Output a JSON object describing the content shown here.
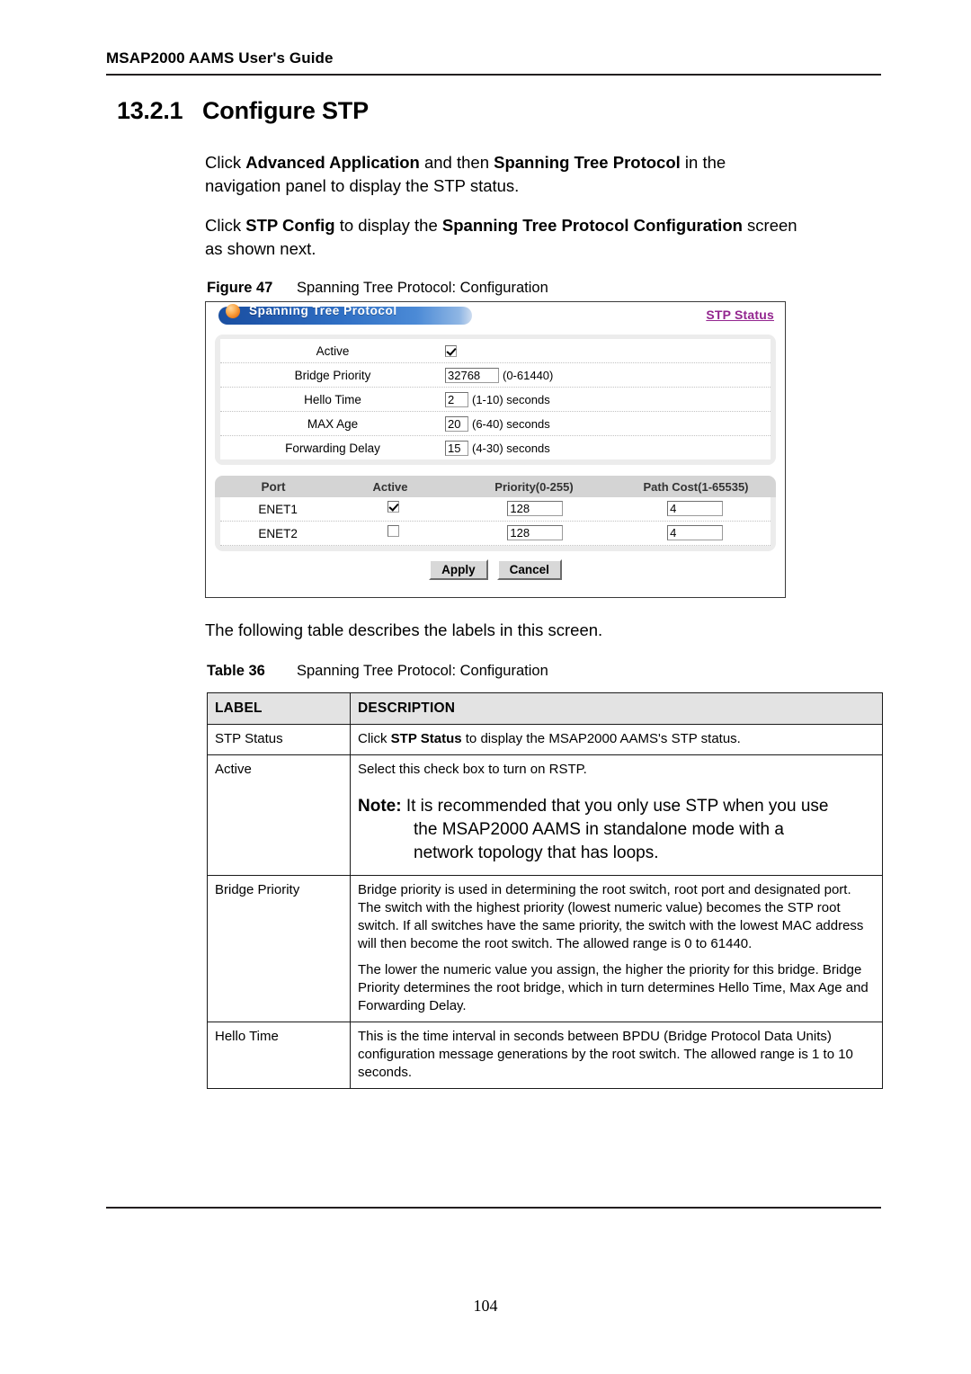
{
  "header": {
    "running_title": "MSAP2000 AAMS User's Guide"
  },
  "heading": {
    "number": "13.2.1",
    "title": "Configure STP"
  },
  "paragraphs": {
    "p1_a": "Click ",
    "p1_b1": "Advanced Application",
    "p1_c": " and then ",
    "p1_b2": "Spanning Tree Protocol",
    "p1_d": " in the navigation panel to display the STP status.",
    "p2_a": "Click ",
    "p2_b1": "STP Config",
    "p2_c": " to display the ",
    "p2_b2": "Spanning Tree Protocol Configuration",
    "p2_d": " screen as shown next.",
    "p3": "The following table describes the labels in this screen."
  },
  "figure": {
    "caption_label": "Figure 47",
    "caption_text": "Spanning Tree Protocol: Configuration",
    "screen": {
      "panel_title": "Spanning Tree Protocol",
      "status_link": "STP Status",
      "accent_blue": "#2f6fc4",
      "accent_orange": "#ec7a17",
      "link_color": "#93268f",
      "settings": [
        {
          "label": "Active",
          "type": "checkbox",
          "checked": true,
          "value": "",
          "hint": ""
        },
        {
          "label": "Bridge Priority",
          "type": "text",
          "checked": false,
          "value": "32768",
          "hint": "(0-61440)"
        },
        {
          "label": "Hello Time",
          "type": "text",
          "checked": false,
          "value": "2",
          "hint": "(1-10) seconds"
        },
        {
          "label": "MAX Age",
          "type": "text",
          "checked": false,
          "value": "20",
          "hint": "(6-40) seconds"
        },
        {
          "label": "Forwarding Delay",
          "type": "text",
          "checked": false,
          "value": "15",
          "hint": "(4-30) seconds"
        }
      ],
      "port_table": {
        "columns": [
          "Port",
          "Active",
          "Priority(0-255)",
          "Path Cost(1-65535)"
        ],
        "rows": [
          {
            "port": "ENET1",
            "active": true,
            "priority": "128",
            "path_cost": "4"
          },
          {
            "port": "ENET2",
            "active": false,
            "priority": "128",
            "path_cost": "4"
          }
        ]
      },
      "buttons": {
        "apply": "Apply",
        "cancel": "Cancel"
      }
    }
  },
  "table": {
    "caption_label": "Table 36",
    "caption_text": "Spanning Tree Protocol: Configuration",
    "columns": {
      "label": "LABEL",
      "description": "DESCRIPTION"
    },
    "rows": {
      "stp_status": {
        "label": "STP Status",
        "desc_a": "Click ",
        "desc_b": "STP Status",
        "desc_c": " to display the MSAP2000 AAMS's STP status."
      },
      "active": {
        "label": "Active",
        "desc": "Select this check box to turn on RSTP.",
        "note_word": "Note:",
        "note_line1": " It is recommended that you only use STP when you use",
        "note_line2": "the MSAP2000 AAMS in standalone mode with a",
        "note_line3": "network topology that has loops."
      },
      "bridge_priority": {
        "label": "Bridge Priority",
        "desc_p1": "Bridge priority is used in determining the root switch, root port and designated port. The switch with the highest priority (lowest numeric value) becomes the STP root switch. If all switches have the same priority, the switch with the lowest MAC address will then become the root switch. The allowed range is 0 to 61440.",
        "desc_p2": "The lower the numeric value you assign, the higher the priority for this bridge. Bridge Priority determines the root bridge, which in turn determines Hello Time, Max Age and Forwarding Delay."
      },
      "hello_time": {
        "label": "Hello Time",
        "desc": " This is the time interval in seconds between BPDU (Bridge Protocol Data Units) configuration message generations by the root switch. The allowed range is 1 to 10 seconds."
      }
    }
  },
  "footer": {
    "page_number": "104"
  }
}
